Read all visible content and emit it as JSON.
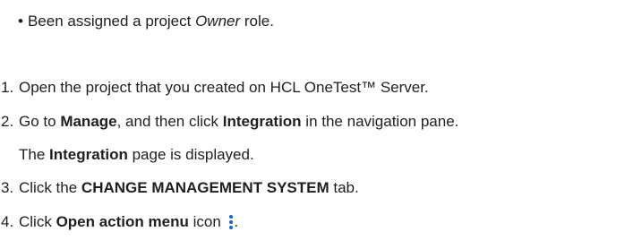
{
  "prereq": {
    "bullet": "•",
    "pre": "Been assigned a project ",
    "em": "Owner",
    "post": " role."
  },
  "steps": [
    {
      "num": "1.",
      "text": "Open the project that you created on HCL OneTest™ Server."
    },
    {
      "num": "2.",
      "pre": "Go to ",
      "b1": "Manage",
      "mid": ", and then click ",
      "b2": "Integration",
      "post": " in the navigation pane."
    },
    {
      "num": "3.",
      "pre": "Click the ",
      "b1": "CHANGE MANAGEMENT SYSTEM",
      "post": " tab."
    },
    {
      "num": "4.",
      "pre": "Click ",
      "b1": "Open action menu",
      "post": " icon ",
      "tail": ".",
      "icon": "kebab-menu-icon"
    }
  ],
  "step2_note": {
    "pre": "The ",
    "b1": "Integration",
    "post": " page is displayed."
  },
  "colors": {
    "text": "#1f1f1f",
    "icon": "#1366c7"
  }
}
